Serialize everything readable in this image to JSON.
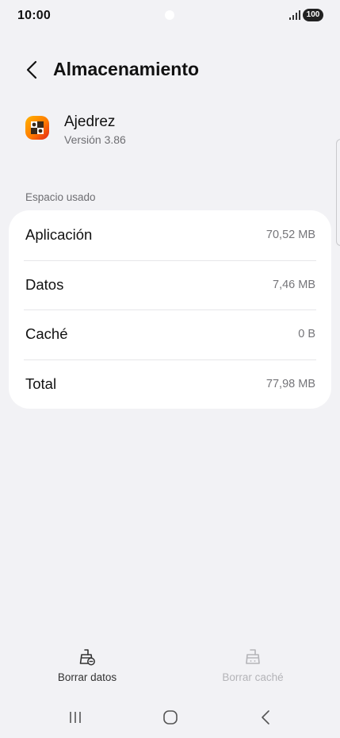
{
  "status_bar": {
    "time": "10:00",
    "battery": "100"
  },
  "header": {
    "title": "Almacenamiento"
  },
  "app": {
    "name": "Ajedrez",
    "version": "Versión 3.86"
  },
  "storage": {
    "section_label": "Espacio usado",
    "rows": [
      {
        "label": "Aplicación",
        "value": "70,52 MB"
      },
      {
        "label": "Datos",
        "value": "7,46 MB"
      },
      {
        "label": "Caché",
        "value": "0 B"
      },
      {
        "label": "Total",
        "value": "77,98 MB"
      }
    ]
  },
  "actions": {
    "clear_data": "Borrar datos",
    "clear_cache": "Borrar caché"
  },
  "icons": {
    "back": "chevron-left-icon",
    "clear_data": "broom-icon",
    "clear_cache": "broom-icon",
    "nav_recents": "recents-icon",
    "nav_home": "home-icon",
    "nav_back": "back-icon"
  },
  "colors": {
    "background": "#f2f2f5",
    "card": "#ffffff",
    "secondary_text": "#6e6e72",
    "disabled_text": "#b4b4b8"
  }
}
